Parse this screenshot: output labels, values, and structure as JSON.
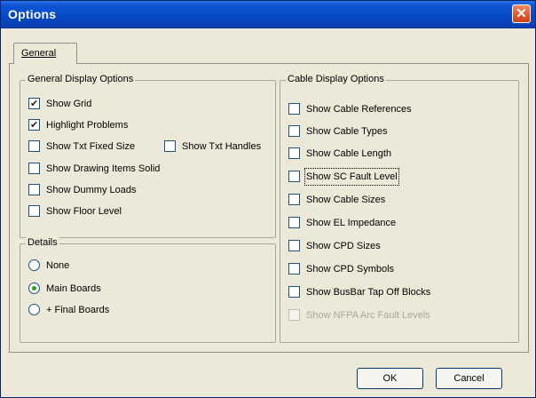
{
  "window": {
    "title": "Options",
    "close_glyph": "✕"
  },
  "tabs": [
    {
      "label": "General",
      "selected": true
    }
  ],
  "general_display_options": {
    "title": "General Display Options",
    "items": [
      {
        "label": "Show Grid",
        "checked": true
      },
      {
        "label": "Highlight Problems",
        "checked": true
      },
      {
        "label": "Show Txt Fixed Size",
        "checked": false
      },
      {
        "label": "Show Txt Handles",
        "checked": false
      },
      {
        "label": "Show Drawing Items Solid",
        "checked": false
      },
      {
        "label": "Show Dummy Loads",
        "checked": false
      },
      {
        "label": "Show Floor Level",
        "checked": false
      }
    ]
  },
  "details": {
    "title": "Details",
    "options": [
      {
        "label": "None",
        "selected": false
      },
      {
        "label": "Main Boards",
        "selected": true
      },
      {
        "label": "+ Final Boards",
        "selected": false
      }
    ]
  },
  "cable_display_options": {
    "title": "Cable Display Options",
    "items": [
      {
        "label": "Show Cable References",
        "checked": false
      },
      {
        "label": "Show Cable Types",
        "checked": false
      },
      {
        "label": "Show Cable Length",
        "checked": false
      },
      {
        "label": "Show SC Fault Level",
        "checked": false,
        "focused": true
      },
      {
        "label": "Show Cable Sizes",
        "checked": false
      },
      {
        "label": "Show EL Impedance",
        "checked": false
      },
      {
        "label": "Show CPD Sizes",
        "checked": false
      },
      {
        "label": "Show CPD Symbols",
        "checked": false
      },
      {
        "label": "Show BusBar Tap Off Blocks",
        "checked": false
      },
      {
        "label": "Show NFPA Arc Fault Levels",
        "checked": false,
        "disabled": true
      }
    ]
  },
  "buttons": {
    "ok": "OK",
    "cancel": "Cancel"
  }
}
